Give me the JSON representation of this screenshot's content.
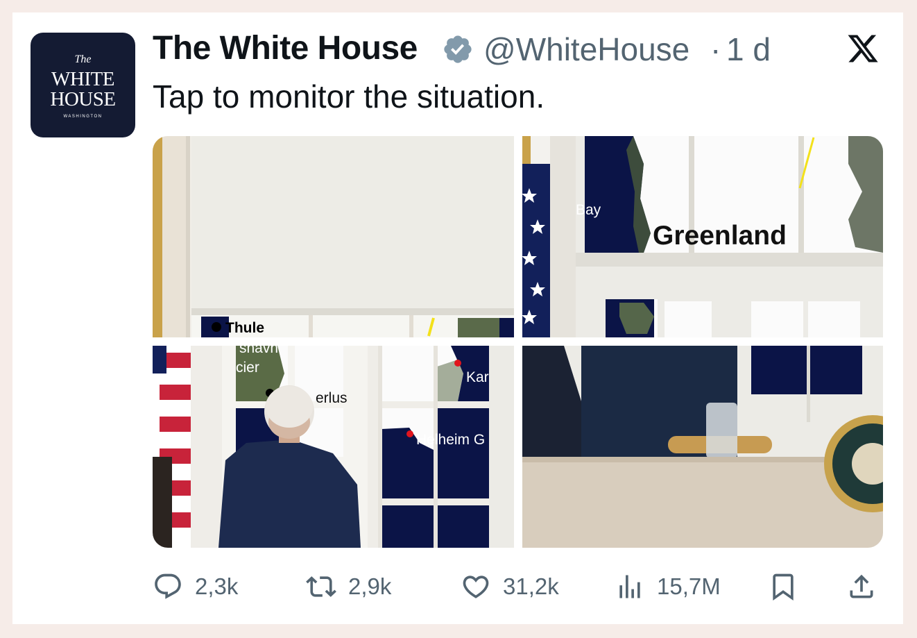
{
  "tweet": {
    "author": {
      "name": "The White House",
      "handle": "@WhiteHouse",
      "separator": "·",
      "time": "1 d",
      "avatar_icon": "white-house-logo",
      "avatar_lines": [
        "The",
        "WHITE",
        "HOUSE",
        "WASHINGTON"
      ]
    },
    "verified_icon": "verified-badge-icon",
    "platform_icon": "x-logo-icon",
    "text": "Tap to monitor the situation.",
    "media": {
      "count": 4,
      "map_labels": {
        "thule": "Thule",
        "shavn": "shavn",
        "cier": "cier",
        "nerlus": "erlus",
        "bay": "Bay",
        "greenland": "Greenland",
        "kar": "Kar",
        "helheim": "Helheim G"
      }
    },
    "actions": [
      {
        "name": "reply",
        "icon": "reply-icon",
        "count": "2,3k"
      },
      {
        "name": "repost",
        "icon": "repost-icon",
        "count": "2,9k"
      },
      {
        "name": "like",
        "icon": "heart-icon",
        "count": "31,2k"
      },
      {
        "name": "views",
        "icon": "views-icon",
        "count": "15,7M"
      },
      {
        "name": "bookmark",
        "icon": "bookmark-icon",
        "count": ""
      },
      {
        "name": "share",
        "icon": "share-icon",
        "count": ""
      }
    ]
  },
  "colors": {
    "background": "#f6ece8",
    "card": "#ffffff",
    "text": "#0f1419",
    "secondary": "#536471",
    "verified": "#829aab",
    "avatar": "#141b33",
    "map_sea": "#0b1447"
  }
}
